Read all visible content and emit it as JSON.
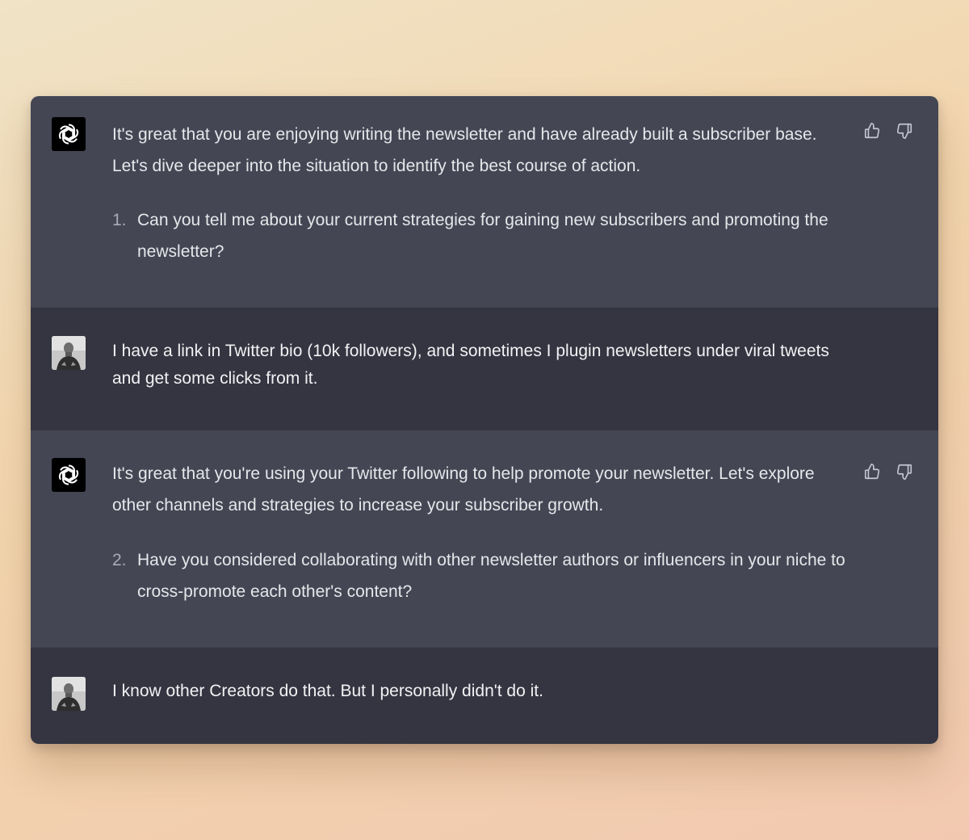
{
  "conversation": {
    "messages": [
      {
        "role": "assistant",
        "text": "It's great that you are enjoying writing the newsletter and have already built a subscriber base. Let's dive deeper into the situation to identify the best course of action.",
        "list_number": "1.",
        "list_text": "Can you tell me about your current strategies for gaining new subscribers and promoting the newsletter?"
      },
      {
        "role": "user",
        "text": "I have a link in Twitter bio (10k followers), and sometimes I plugin newsletters under viral tweets and get some clicks from it."
      },
      {
        "role": "assistant",
        "text": "It's great that you're using your Twitter following to help promote your newsletter. Let's explore other channels and strategies to increase your subscriber growth.",
        "list_number": "2.",
        "list_text": "Have you considered collaborating with other newsletter authors or influencers in your niche to cross-promote each other's content?"
      },
      {
        "role": "user",
        "text": "I know other Creators do that. But I personally didn't do it."
      }
    ]
  },
  "icons": {
    "assistant_avatar": "openai-logo-icon",
    "user_avatar": "user-photo",
    "like": "thumbs-up-icon",
    "dislike": "thumbs-down-icon"
  },
  "colors": {
    "assistant_bg": "#444654",
    "user_bg": "#343541",
    "text": "#e6e7ea",
    "list_number": "#a9abb5"
  }
}
